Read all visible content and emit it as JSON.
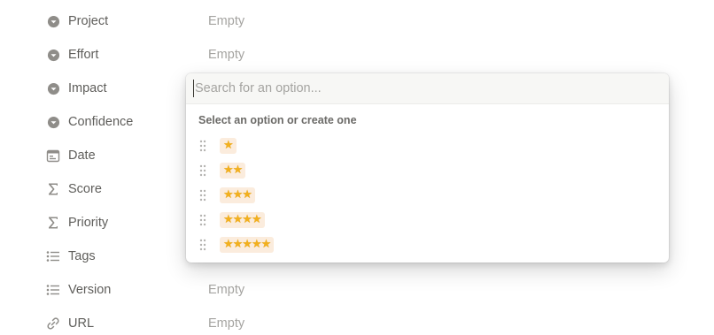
{
  "properties": [
    {
      "label": "Project",
      "value": "Empty",
      "icon": "select-icon"
    },
    {
      "label": "Effort",
      "value": "Empty",
      "icon": "select-icon"
    },
    {
      "label": "Impact",
      "value": "",
      "icon": "select-icon"
    },
    {
      "label": "Confidence",
      "value": "",
      "icon": "select-icon"
    },
    {
      "label": "Date",
      "value": "",
      "icon": "calendar-icon"
    },
    {
      "label": "Score",
      "value": "",
      "icon": "sigma-icon"
    },
    {
      "label": "Priority",
      "value": "",
      "icon": "sigma-icon"
    },
    {
      "label": "Tags",
      "value": "",
      "icon": "list-icon"
    },
    {
      "label": "Version",
      "value": "Empty",
      "icon": "list-icon"
    },
    {
      "label": "URL",
      "value": "Empty",
      "icon": "link-icon"
    }
  ],
  "dropdown": {
    "search_placeholder": "Search for an option...",
    "search_value": "",
    "hint": "Select an option or create one",
    "options": [
      {
        "stars": "★",
        "count": 1
      },
      {
        "stars": "★★",
        "count": 2
      },
      {
        "stars": "★★★",
        "count": 3
      },
      {
        "stars": "★★★★",
        "count": 4
      },
      {
        "stars": "★★★★★",
        "count": 5
      }
    ]
  },
  "colors": {
    "tag_background": "#fbecdd",
    "star": "#f2b01e",
    "label_text": "#5f5e5b",
    "empty_text": "#a5a4a1"
  }
}
